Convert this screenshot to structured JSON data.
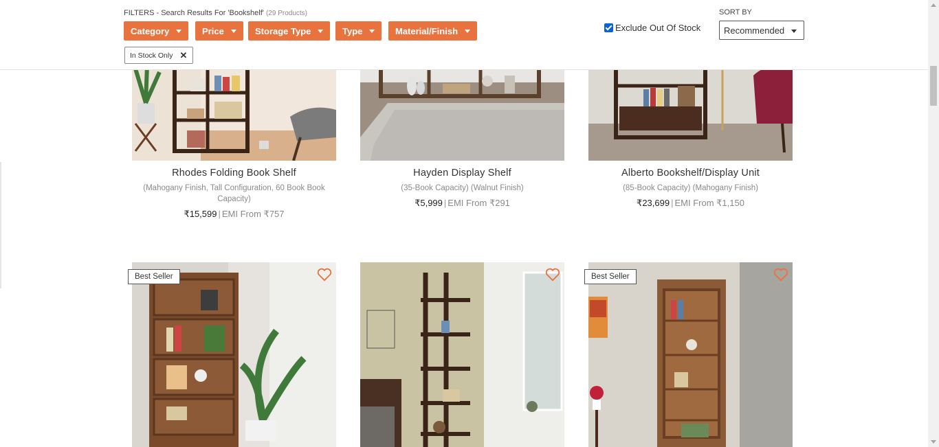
{
  "filters": {
    "title": "FILTERS - Search Results For 'Bookshelf'",
    "count": "(29 Products)",
    "buttons": [
      "Category",
      "Price",
      "Storage Type",
      "Type",
      "Material/Finish"
    ],
    "active_chip": "In Stock Only",
    "exclude_label": "Exclude Out Of Stock",
    "exclude_checked": true
  },
  "sort": {
    "label": "SORT BY",
    "selected": "Recommended"
  },
  "products_row1": [
    {
      "name": "Rhodes Folding Book Shelf",
      "desc": "(Mahogany Finish, Tall Configuration, 60 Book Book Capacity)",
      "price": "₹15,599",
      "emi": "EMI From ₹757"
    },
    {
      "name": "Hayden Display Shelf",
      "desc": "(35-Book Capacity) (Walnut Finish)",
      "price": "₹5,999",
      "emi": "EMI From ₹291"
    },
    {
      "name": "Alberto Bookshelf/Display Unit",
      "desc": "(85-Book Capacity) (Mahogany Finish)",
      "price": "₹23,699",
      "emi": "EMI From ₹1,150"
    }
  ],
  "products_row2": [
    {
      "badge": "Best Seller"
    },
    {
      "badge": ""
    },
    {
      "badge": "Best Seller"
    }
  ],
  "colors": {
    "accent": "#e9733e",
    "checkbox": "#0a63d1"
  }
}
